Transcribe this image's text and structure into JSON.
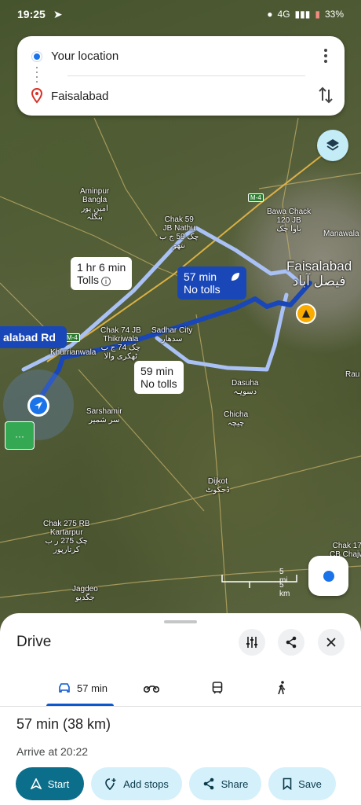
{
  "status_bar": {
    "time": "19:25",
    "network": "4G",
    "battery": "33%"
  },
  "directions": {
    "origin": "Your location",
    "destination": "Faisalabad"
  },
  "map": {
    "places": {
      "aminpur": "Aminpur\nBangla\nامین پور\nبنگلہ",
      "chak59": "Chak 59\nJB Nathu\nچک 59 ج ب\nنتھو",
      "bawa": "Bawa Chack\n120 JB\nباوا چک",
      "manawala": "Manawala",
      "faisalabad": "Faisalabad\nفیصل آباد",
      "chak74": "Chak 74 JB\nThikriwala\nچک 74 ج ب\nٹھکری والا",
      "sadhar": "Sadhar City\nسدھار",
      "dasuha": "Dasuha\nدسوہہ",
      "chicha": "Chicha\nچیچہ",
      "dijkot": "Dijkot\nڈجکوٹ",
      "sarshamir": "Sarshamir\nسر شمیر",
      "chak275": "Chak 275 RB\nKartarpur\nچک 275 ر ب\nکرتارپور",
      "jagdeo": "Jagdeo\nجگدیو",
      "chak17": "Chak 17\nCB Chajw",
      "rau": "Rau",
      "khurrianwala": "Khurrianwala",
      "m4a": "M-4",
      "m4b": "M-4"
    },
    "route_labels": {
      "alt1_time": "1 hr 6 min",
      "alt1_note": "Tolls",
      "main_time": "57 min",
      "main_note": "No tolls",
      "alt2_time": "59 min",
      "alt2_note": "No tolls",
      "dest_road": "alabad Rd"
    },
    "scale": {
      "mi": "5 mi",
      "km": "5 km"
    }
  },
  "sheet": {
    "title": "Drive",
    "tabs": [
      {
        "label": "57 min",
        "icon": "car-icon"
      },
      {
        "label": "",
        "icon": "motorbike-icon"
      },
      {
        "label": "",
        "icon": "transit-icon"
      },
      {
        "label": "",
        "icon": "walk-icon"
      }
    ],
    "duration": "57 min (38 km)",
    "arrive": "Arrive at 20:22",
    "actions": {
      "start": "Start",
      "add_stops": "Add stops",
      "share": "Share",
      "save": "Save"
    }
  },
  "colors": {
    "route_primary": "#1a47b8",
    "route_alt": "#a9c1f5",
    "start_button": "#0b6e8a",
    "chip_bg": "#d3f0fb"
  }
}
